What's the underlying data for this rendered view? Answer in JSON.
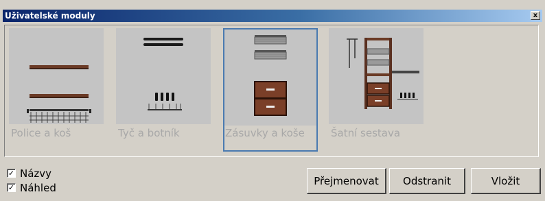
{
  "window": {
    "title": "Uživatelské moduly",
    "close_glyph": "x"
  },
  "modules": [
    {
      "label": "Police a koš",
      "icon": "shelf-and-basket-thumbnail",
      "selected": false
    },
    {
      "label": "Tyč a botník",
      "icon": "rod-and-shoe-rack-thumbnail",
      "selected": false
    },
    {
      "label": "Zásuvky a koše",
      "icon": "drawers-and-baskets-thumbnail",
      "selected": true
    },
    {
      "label": "Šatní sestava",
      "icon": "wardrobe-set-thumbnail",
      "selected": false
    }
  ],
  "options": {
    "names_label": "Názvy",
    "names_checked": true,
    "preview_label": "Náhled",
    "preview_checked": true,
    "check_glyph": "✓"
  },
  "buttons": {
    "rename": "Přejmenovat",
    "remove": "Odstranit",
    "insert": "Vložit"
  },
  "colors": {
    "title_gradient_start": "#0a246a",
    "selection_border": "#4a7ab0",
    "thumbnail_bg": "#c4c4c4",
    "wood": "#6b3b26"
  }
}
